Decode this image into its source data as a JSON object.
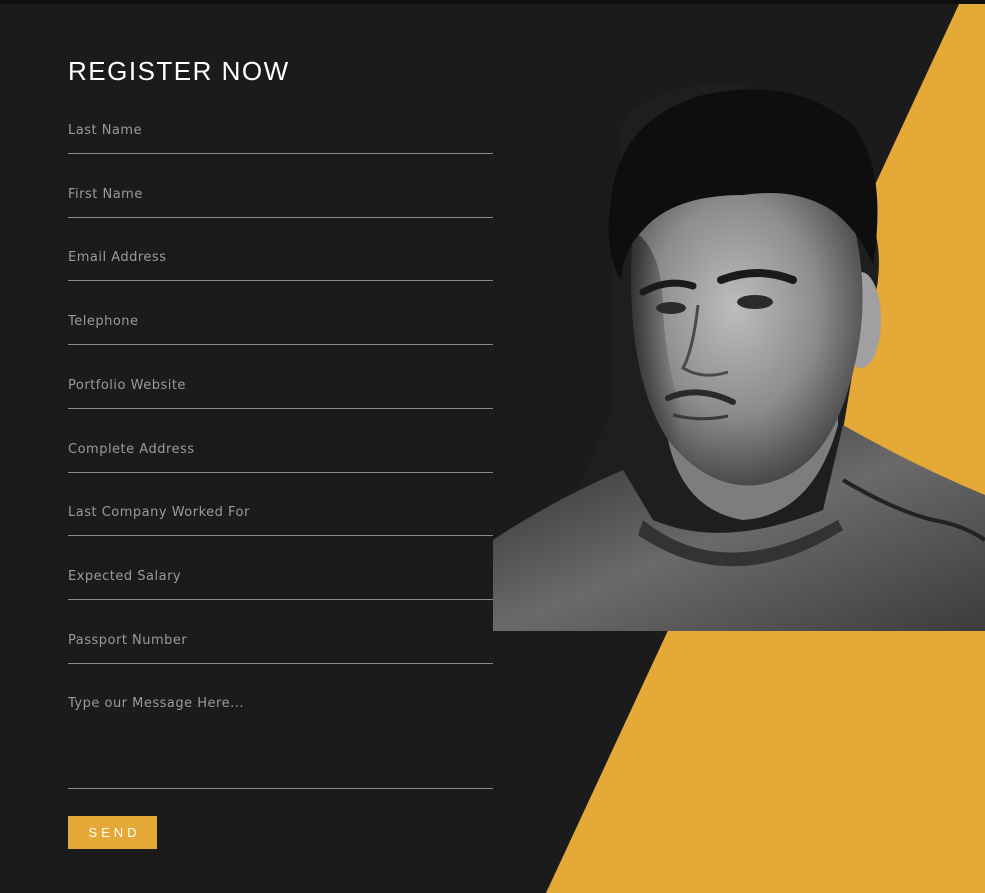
{
  "form": {
    "title": "REGISTER NOW",
    "fields": [
      {
        "placeholder": "Last Name",
        "value": ""
      },
      {
        "placeholder": "First Name",
        "value": ""
      },
      {
        "placeholder": "Email Address",
        "value": ""
      },
      {
        "placeholder": "Telephone",
        "value": ""
      },
      {
        "placeholder": "Portfolio Website",
        "value": ""
      },
      {
        "placeholder": "Complete Address",
        "value": ""
      },
      {
        "placeholder": "Last Company Worked For",
        "value": ""
      },
      {
        "placeholder": "Expected Salary",
        "value": ""
      },
      {
        "placeholder": "Passport Number",
        "value": ""
      }
    ],
    "message": {
      "placeholder": "Type our Message Here...",
      "value": ""
    },
    "send_label": "SEND"
  },
  "colors": {
    "background": "#1b1b1b",
    "accent": "#e4a936",
    "text": "#ffffff",
    "placeholder": "#9a9a9a",
    "underline": "#8a8a8a"
  },
  "photo": {
    "subject": "portrait-photo"
  }
}
